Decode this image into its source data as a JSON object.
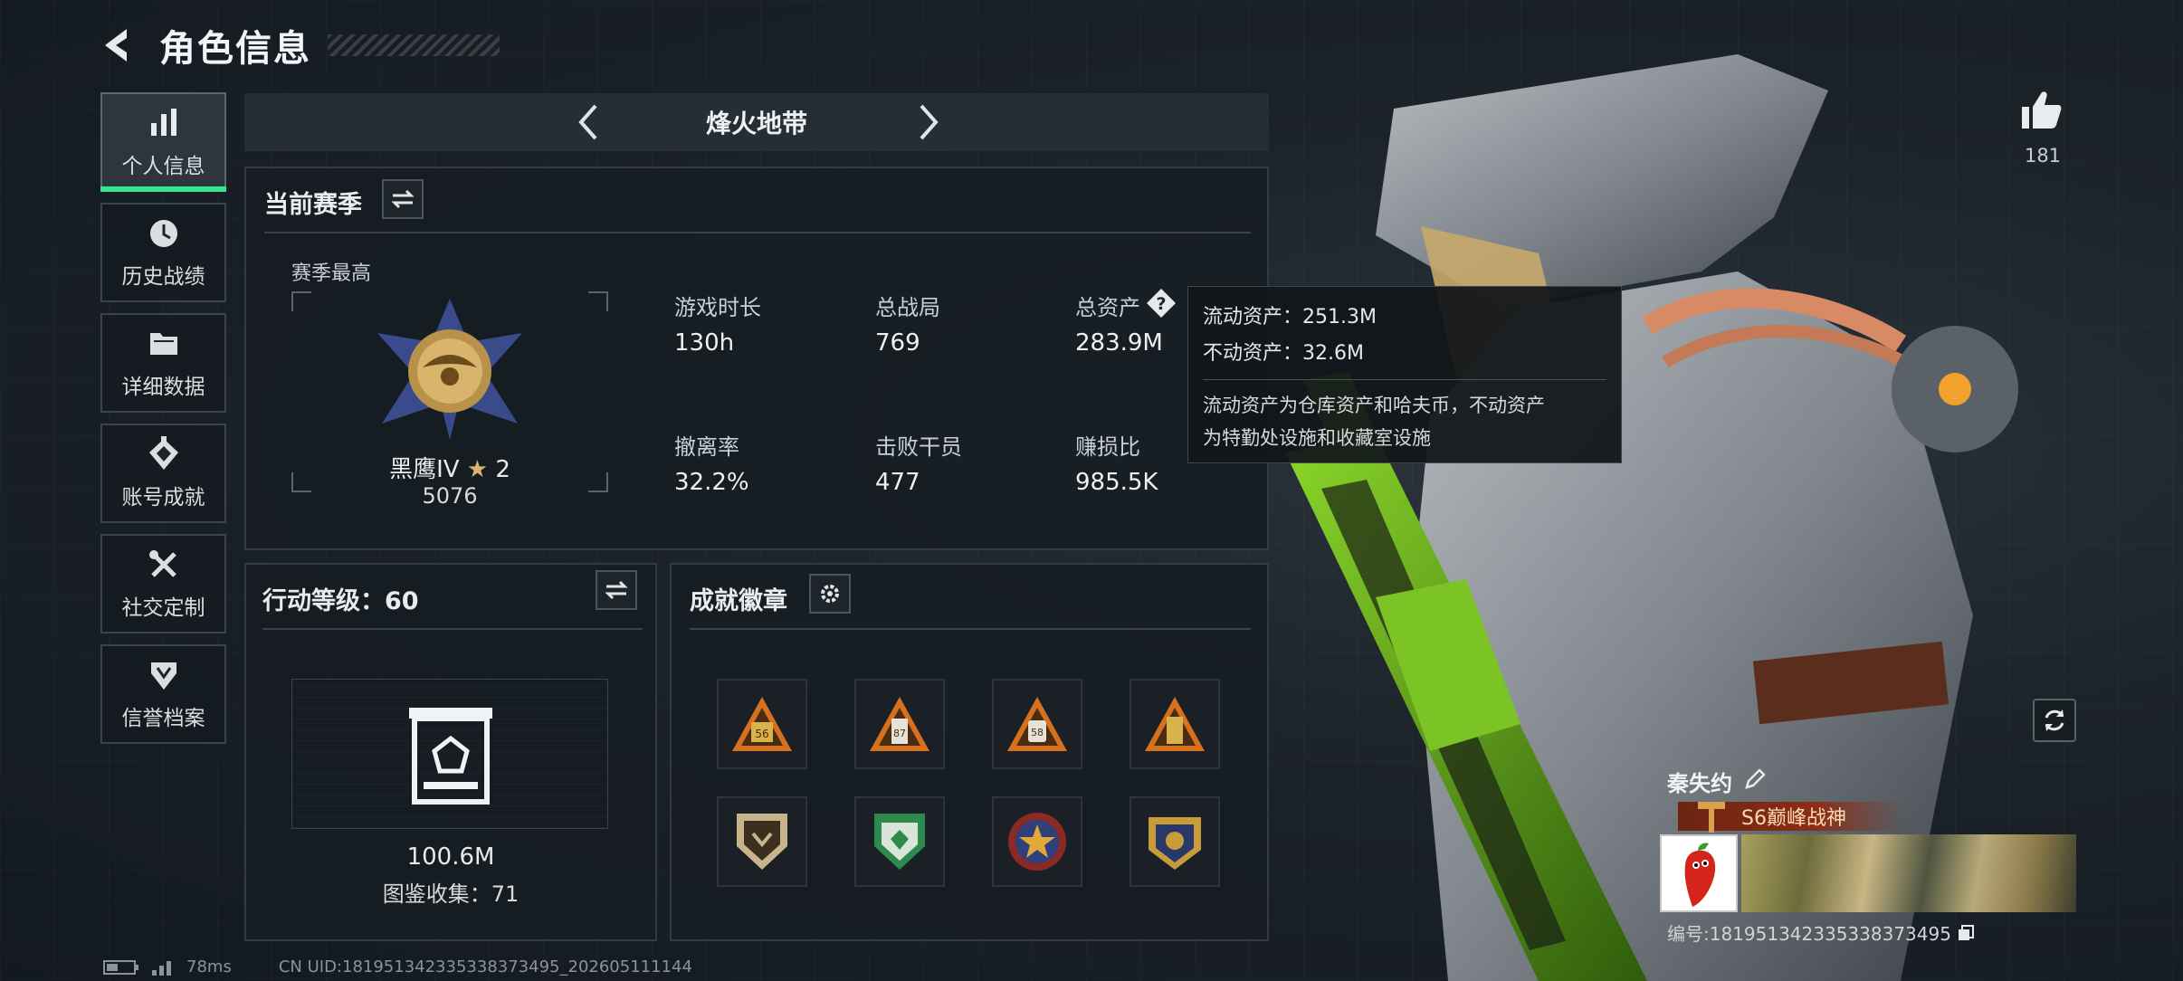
{
  "header": {
    "title": "角色信息"
  },
  "sidebar": {
    "items": [
      {
        "label": "个人信息",
        "icon": "bar-chart-icon",
        "active": true
      },
      {
        "label": "历史战绩",
        "icon": "clock-history-icon",
        "active": false
      },
      {
        "label": "详细数据",
        "icon": "folder-icon",
        "active": false
      },
      {
        "label": "账号成就",
        "icon": "achievement-icon",
        "active": false
      },
      {
        "label": "社交定制",
        "icon": "tools-icon",
        "active": false
      },
      {
        "label": "信誉档案",
        "icon": "shield-icon",
        "active": false
      }
    ]
  },
  "zone": {
    "title": "烽火地带"
  },
  "season": {
    "title": "当前赛季",
    "best_label": "赛季最高",
    "rank_name": "黑鹰IV",
    "rank_stars": "2",
    "rank_points": "5076",
    "stats": [
      {
        "label": "游戏时长",
        "value": "130h"
      },
      {
        "label": "总战局",
        "value": "769"
      },
      {
        "label": "总资产",
        "value": "283.9M"
      },
      {
        "label": "撤离率",
        "value": "32.2%"
      },
      {
        "label": "击败干员",
        "value": "477"
      },
      {
        "label": "赚损比",
        "value": "985.5K"
      }
    ]
  },
  "tooltip": {
    "liquid": "流动资产：251.3M",
    "fixed": "不动资产：32.6M",
    "desc_line1": "流动资产为仓库资产和哈夫币，不动资产",
    "desc_line2": "为特勤处设施和收藏室设施"
  },
  "action_level": {
    "title": "行动等级：60",
    "value": "100.6M",
    "collection": "图鉴收集：71"
  },
  "achievements": {
    "title": "成就徽章",
    "badge_row1_labels": [
      "56",
      "87",
      "58",
      ""
    ]
  },
  "social": {
    "likes": "181"
  },
  "card": {
    "name": "秦失约",
    "title": "S6巅峰战神",
    "id": "编号:1819513423353383734​95"
  },
  "status": {
    "ping": "78ms",
    "uid": "CN UID:1819513423353383734​95_202605111144"
  },
  "colors": {
    "accent": "#37e58e",
    "panel_border": "#323b43",
    "tooltip_bg": "#12161a"
  }
}
